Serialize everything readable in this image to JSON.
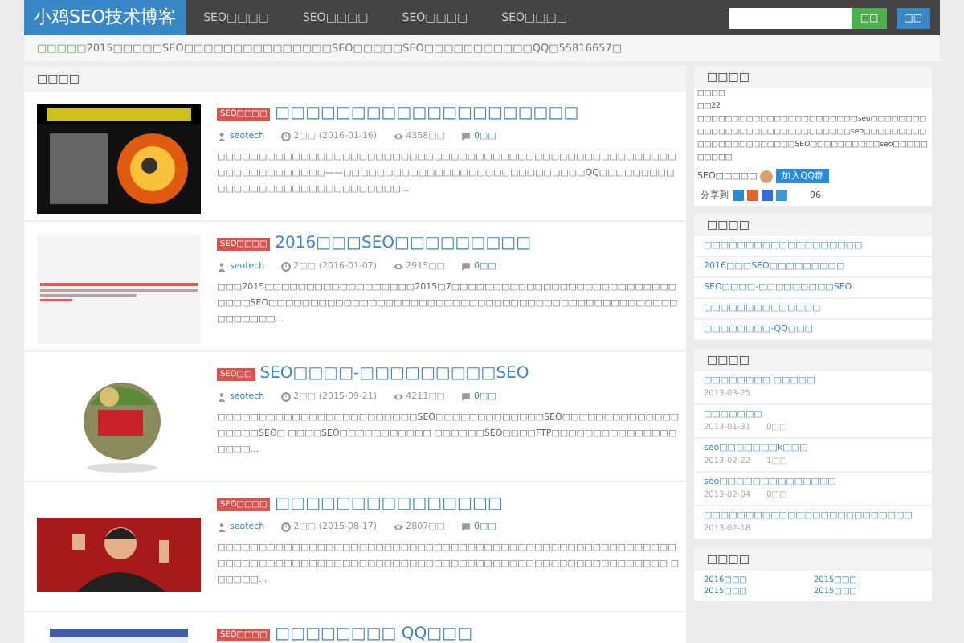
{
  "header": {
    "logo": "小鸡SEO技术博客",
    "nav": [
      {
        "label": "SEO□□□□",
        "selected": false
      },
      {
        "label": "SEO□□□□",
        "selected": false
      },
      {
        "label": "SEO□□□□",
        "selected": false
      },
      {
        "label": "SEO□□□□",
        "selected": false
      }
    ],
    "search_button": "□□",
    "extra_button": "□□"
  },
  "notice": {
    "label": "□□□□□",
    "text": "2015□□□□□SEO□□□□□□□□□□□□□□□SEO□□□□□SEO□□□□□□□□□□□QQ□55816657□"
  },
  "main": {
    "title": "□□□□",
    "posts": [
      {
        "tag": "SEO□□□□",
        "title": "□□□□□□□□□□□□□□□□□□□□",
        "author": "seotech",
        "time": "2□□ (2016-01-16)",
        "views": "4358□□",
        "comments": "0□□",
        "excerpt": "□□□□□□□□□□□□□□□□□□□□□□□□□□□□□□□□□□□□□□□□□□□□□□□□□□□□□□□□□□□□□□□□□□□□——□□□□□□□□□□□□□□□□□□□□□□□□□□□□□QQ□□□□□□□□□□□□□□□□□□□□□□□□□□□□□□□..."
      },
      {
        "tag": "SEO□□□□",
        "title": "2016□□□SEO□□□□□□□□□",
        "author": "seotech",
        "time": "2□□ (2016-01-07)",
        "views": "2915□□",
        "comments": "0□□",
        "excerpt": "□□□2015□□□□□□□□□□□□□□□□□□2015□7□□□□□□□□□□□□□□□□□□□□□□□□□□□□□□□SEO□□□□□□□□□□□□□□□□□□□□□□□□□□□□□□□□□□□□□□□□□□□□□□□□□□□□□□□□..."
      },
      {
        "tag": "SEO□□",
        "title": "SEO□□□□-□□□□□□□□□SEO",
        "author": "seotech",
        "time": "2□□ (2015-09-21)",
        "views": "4211□□",
        "comments": "0□□",
        "excerpt": "□□□□□□□□□□□□□□□□□□□□□□□□SEO□□□□□□□□□□□□□SEO□□□□□□□□□□□□□□□□□□□SEO□ □□□□SEO□□□□□□□□□□□ □□□□□□SEO□□□□FTP□□□□□□□□□□□□□□□□□□□..."
      },
      {
        "tag": "SEO□□□□",
        "title": "□□□□□□□□□□□□□□□",
        "author": "seotech",
        "time": "2□□ (2015-08-17)",
        "views": "2807□□",
        "comments": "0□□",
        "excerpt": "□□□□□□□□□□□□□□□□□□□□□□□□□□□□□□□□□□□□□□□□□□□□□□□□□□□□□□□□□□□□□□□□□□□□□□□□□□□□□□□□□□□□□□□□□□□□□□□□□□□□□□□□□□□□□ □□□□□□..."
      },
      {
        "tag": "SEO□□□□",
        "title": "□□□□□□□□ QQ□□□"
      }
    ]
  },
  "about": {
    "title": "□□□□",
    "lines": [
      "□□□□",
      "□□22",
      "□□□□□□□□□□□□□□□□□□□□□□□seo□□□□□□□□□□□□□□□□□□□□□□□□□□□□□□seo□□□□□□□□□□□□□□□□□□□□□□□SEO□□□□□□□□□□seo□□□□□□□□□□"
    ],
    "group_label": "SEO□□□□□",
    "group_button": "加入QQ群",
    "share_label": "分享到",
    "share_count": "96"
  },
  "hot": {
    "title": "□□□□",
    "links": [
      "□□□□□□□□□□□□□□□□□□□",
      "2016□□□SEO□□□□□□□□□",
      "SEO□□□□-□□□□□□□□□SEO",
      "□□□□□□□□□□□□□□",
      "□□□□□□□□-QQ□□□"
    ]
  },
  "recent": {
    "title": "□□□□",
    "items": [
      {
        "title": "□□□□□□□□ □□□□□",
        "date": "2013-03-25"
      },
      {
        "title": "□□□□□□□",
        "date": "2013-01-31",
        "comments": "0□□"
      },
      {
        "title": "seo□□□□□□□k□□□",
        "date": "2013-02-22",
        "comments": "1□□"
      },
      {
        "title": "seo□□□□□□□□□□□□□□",
        "date": "2013-02-04",
        "comments": "0□□"
      },
      {
        "title": "□□□□□□□□□□□□□□□□□□□□□□□□□",
        "date": "2013-02-18"
      }
    ]
  },
  "archive": {
    "title": "□□□□",
    "items": [
      "2016□□□",
      "2015□□□",
      "2015□□□",
      "2015□□□"
    ]
  }
}
